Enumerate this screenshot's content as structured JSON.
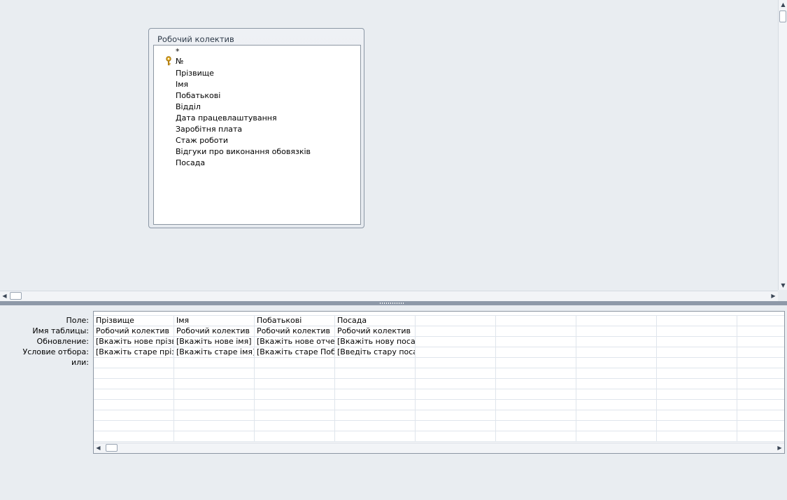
{
  "design": {
    "table": {
      "title": "Робочий колектив",
      "fields": [
        "*",
        "№",
        "Прізвище",
        "Імя",
        "Побатькові",
        "Відділ",
        "Дата працевлаштування",
        "Заробітня плата",
        "Стаж роботи",
        "Відгуки про виконання обовязків",
        "Посада"
      ],
      "primary_key_field": "№"
    }
  },
  "grid": {
    "row_labels": [
      "Поле:",
      "Имя таблицы:",
      "Обновление:",
      "Условие отбора:",
      "или:"
    ],
    "columns": [
      {
        "field": "Прізвище",
        "table": "Робочий колектив",
        "update": "[Вкажіть нове прізвище]",
        "criteria": "[Вкажіть старе прізвище]",
        "or": ""
      },
      {
        "field": "Імя",
        "table": "Робочий колектив",
        "update": "[Вкажіть нове імя]",
        "criteria": "[Вкажіть  старе імя]",
        "or": ""
      },
      {
        "field": "Побатькові",
        "table": "Робочий колектив",
        "update": "[Вкажіть нове отчество]",
        "criteria": "[Вкажіть старе Побатькові]",
        "or": ""
      },
      {
        "field": "Посада",
        "table": "Робочий колектив",
        "update": "[Вкажіть нову посаду]",
        "criteria": "[Введіть стару посаду]",
        "or": ""
      }
    ]
  },
  "icons": {
    "key": "key-icon",
    "scroll_up": "arrow-up-icon",
    "scroll_down": "arrow-down-icon",
    "scroll_left": "arrow-left-icon",
    "scroll_right": "arrow-right-icon"
  },
  "colors": {
    "background": "#e9edf1",
    "splitter": "#8e99a8",
    "grid_line": "#dfe5ec",
    "key_gold": "#d9a520"
  }
}
